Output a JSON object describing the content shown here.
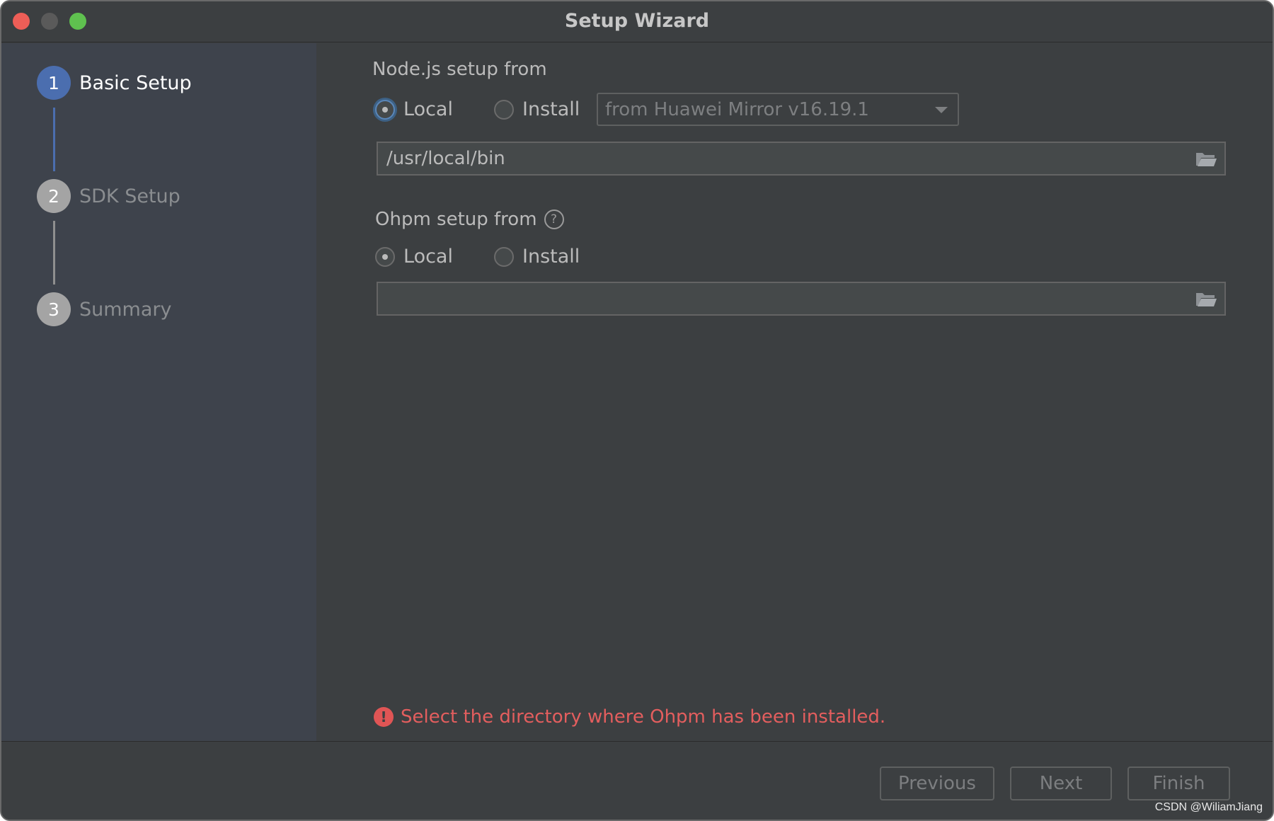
{
  "window": {
    "title": "Setup Wizard"
  },
  "steps": [
    {
      "number": "1",
      "label": "Basic Setup",
      "active": true
    },
    {
      "number": "2",
      "label": "SDK Setup",
      "active": false
    },
    {
      "number": "3",
      "label": "Summary",
      "active": false
    }
  ],
  "node": {
    "section_label": "Node.js setup from",
    "radio_local": "Local",
    "radio_install": "Install",
    "selected": "Local",
    "mirror_select": "from Huawei Mirror v16.19.1",
    "path_value": "/usr/local/bin"
  },
  "ohpm": {
    "section_label": "Ohpm setup from",
    "help_icon": "?",
    "radio_local": "Local",
    "radio_install": "Install",
    "selected": "Local",
    "path_value": ""
  },
  "error": {
    "icon": "!",
    "message": "Select the directory where Ohpm has been installed."
  },
  "footer": {
    "previous": "Previous",
    "next": "Next",
    "finish": "Finish"
  },
  "watermark": "CSDN @WiliamJiang",
  "colors": {
    "accent": "#4b6eaf",
    "error": "#e35e5e",
    "background": "#3c3f41",
    "sidebar": "#3e434c"
  }
}
